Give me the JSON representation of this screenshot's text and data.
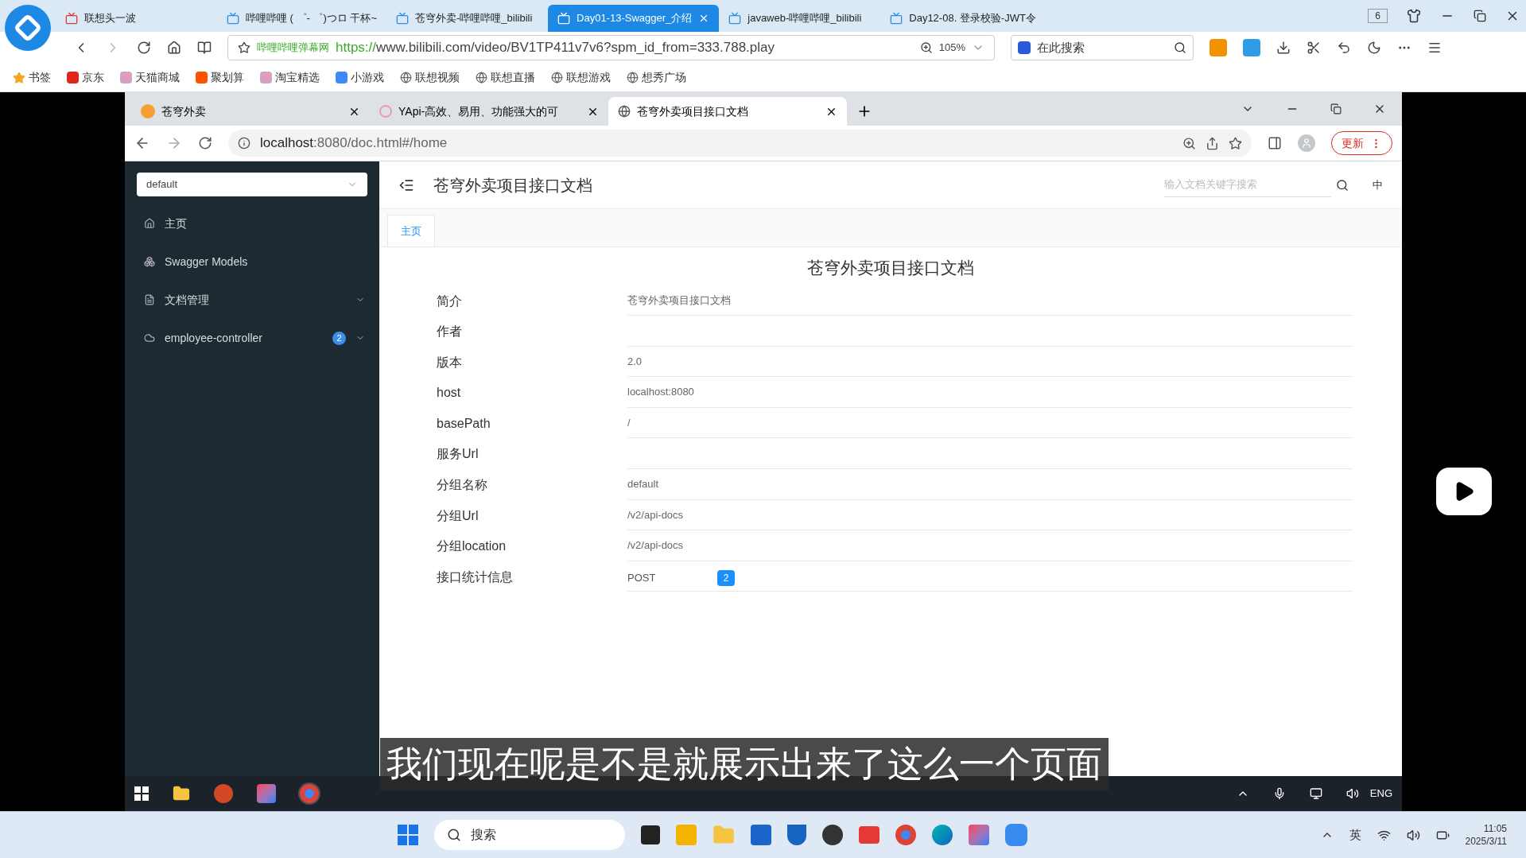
{
  "outer_browser": {
    "tabs": [
      {
        "label": "联想头一波",
        "selected": false
      },
      {
        "label": "哔哩哔哩 ( ゜- ゜)つロ 干杯~",
        "selected": false
      },
      {
        "label": "苍穹外卖-哔哩哔哩_bilibili",
        "selected": false
      },
      {
        "label": "Day01-13-Swagger_介绍",
        "selected": true
      },
      {
        "label": "javaweb-哔哩哔哩_bilibili",
        "selected": false
      },
      {
        "label": "Day12-08. 登录校验-JWT令",
        "selected": false
      }
    ],
    "tab_count": "6",
    "site_name": "哔哩哔哩弹幕网",
    "url_scheme": "https://",
    "url_rest": "www.bilibili.com/video/BV1TP411v7v6?spm_id_from=333.788.play",
    "zoom": "105%",
    "search_placeholder": "在此搜索",
    "bookmarks": [
      "书签",
      "京东",
      "天猫商城",
      "聚划算",
      "淘宝精选",
      "小游戏",
      "联想视频",
      "联想直播",
      "联想游戏",
      "想秀广场"
    ]
  },
  "inner_browser": {
    "tabs": [
      {
        "label": "苍穹外卖",
        "selected": false
      },
      {
        "label": "YApi-高效、易用、功能强大的可",
        "selected": false
      },
      {
        "label": "苍穹外卖项目接口文档",
        "selected": true
      }
    ],
    "url_host": "localhost",
    "url_rest": ":8080/doc.html#/home",
    "update_button": "更新"
  },
  "app": {
    "group_select": "default",
    "sidebar": {
      "items": [
        {
          "kind": "home",
          "label": "主页",
          "expandable": false
        },
        {
          "kind": "models",
          "label": "Swagger Models",
          "expandable": false
        },
        {
          "kind": "docs",
          "label": "文档管理",
          "expandable": true
        },
        {
          "kind": "controller",
          "label": "employee-controller",
          "badge": "2",
          "expandable": true
        }
      ]
    },
    "header": {
      "title": "苍穹外卖项目接口文档",
      "search_placeholder": "输入文档关键字搜索",
      "language": "中"
    },
    "tabs": [
      {
        "label": "主页",
        "selected": true
      }
    ],
    "doc_title": "苍穹外卖项目接口文档",
    "rows": [
      {
        "label": "简介",
        "value": "苍穹外卖项目接口文档"
      },
      {
        "label": "作者"
      },
      {
        "label": "版本",
        "value": "2.0"
      },
      {
        "label": "host",
        "value": "localhost:8080"
      },
      {
        "label": "basePath",
        "value": "/"
      },
      {
        "label": "服务Url"
      },
      {
        "label": "分组名称",
        "value": "default"
      },
      {
        "label": "分组Url",
        "value": "/v2/api-docs"
      },
      {
        "label": "分组location",
        "value": "/v2/api-docs"
      },
      {
        "label": "接口统计信息",
        "stats": [
          {
            "method": "POST",
            "count": "2"
          }
        ]
      }
    ]
  },
  "subtitle": "我们现在呢是不是就展示出来了这么一个页面",
  "inner_taskbar": {
    "language": "ENG"
  },
  "taskbar": {
    "search_placeholder": "搜索",
    "ime": "英",
    "time": "11:05",
    "date": "2025/3/11"
  }
}
